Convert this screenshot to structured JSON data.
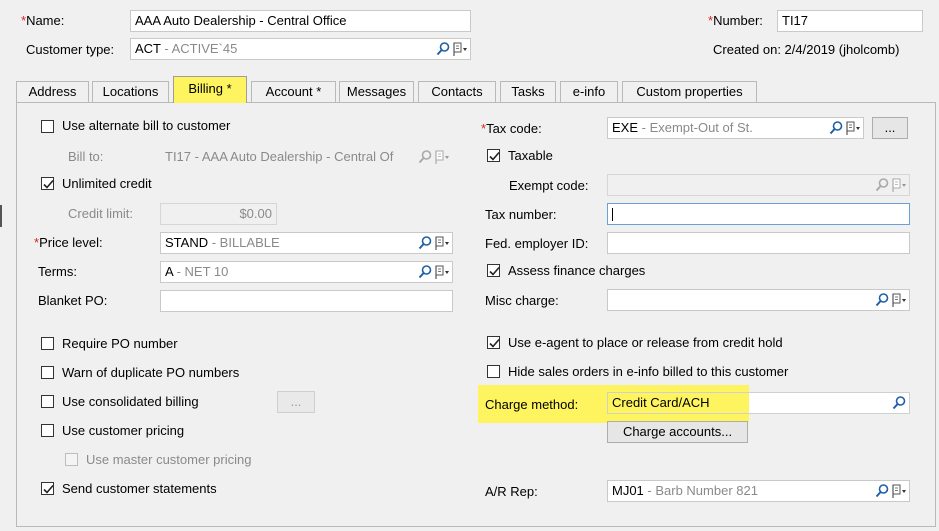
{
  "header": {
    "name_label": "Name:",
    "name_value": "AAA Auto Dealership - Central Office",
    "customer_type_label": "Customer type:",
    "customer_type_code": "ACT",
    "customer_type_desc": " - ACTIVE`45",
    "number_label": "Number:",
    "number_value": "TI17",
    "created_on": "Created on: 2/4/2019 (jholcomb)"
  },
  "tabs": [
    {
      "label": "Address"
    },
    {
      "label": "Locations"
    },
    {
      "label": "Billing  *"
    },
    {
      "label": "Account *"
    },
    {
      "label": "Messages"
    },
    {
      "label": "Contacts"
    },
    {
      "label": "Tasks"
    },
    {
      "label": "e-info"
    },
    {
      "label": "Custom properties"
    }
  ],
  "left": {
    "use_alternate_bill": "Use alternate bill to customer",
    "bill_to_label": "Bill to:",
    "bill_to_value": "TI17 - AAA Auto Dealership - Central Of",
    "unlimited_credit": "Unlimited credit",
    "credit_limit_label": "Credit limit:",
    "credit_limit_value": "$0.00",
    "price_level_label": "Price level:",
    "price_level_code": "STAND",
    "price_level_desc": " - BILLABLE",
    "terms_label": "Terms:",
    "terms_code": "A",
    "terms_desc": " - NET 10",
    "blanket_po_label": "Blanket PO:",
    "blanket_po_value": "",
    "require_po": "Require PO number",
    "warn_duplicate_po": "Warn of duplicate PO numbers",
    "consolidated_billing": "Use consolidated billing",
    "consolidated_btn": "...",
    "customer_pricing": "Use customer pricing",
    "master_pricing": "Use master customer pricing",
    "send_statements": "Send customer statements"
  },
  "right": {
    "tax_code_label": "Tax code:",
    "tax_code_code": "EXE",
    "tax_code_desc": " - Exempt-Out of St.",
    "tax_code_btn": "...",
    "taxable": "Taxable",
    "exempt_code_label": "Exempt code:",
    "exempt_code_value": "",
    "tax_number_label": "Tax number:",
    "tax_number_value": "",
    "fed_employer_label": "Fed. employer ID:",
    "fed_employer_value": "",
    "assess_finance": "Assess finance charges",
    "misc_charge_label": "Misc charge:",
    "misc_charge_value": "",
    "use_eagent": "Use e-agent to place or release from credit hold",
    "hide_sales_orders": "Hide sales orders in e-info billed to this customer",
    "charge_method_label": "Charge method:",
    "charge_method_value": "Credit Card/ACH",
    "charge_accounts_btn": "Charge accounts...",
    "ar_rep_label": "A/R Rep:",
    "ar_rep_code": "MJ01",
    "ar_rep_desc": " - Barb Number 821"
  },
  "colors": {
    "highlight": "#fdf45f",
    "required_asterisk": "#d8261f",
    "accent_blue": "#1f5fa8"
  },
  "icons": [
    "search-icon",
    "flag-dropdown-icon",
    "checkmark-icon"
  ]
}
